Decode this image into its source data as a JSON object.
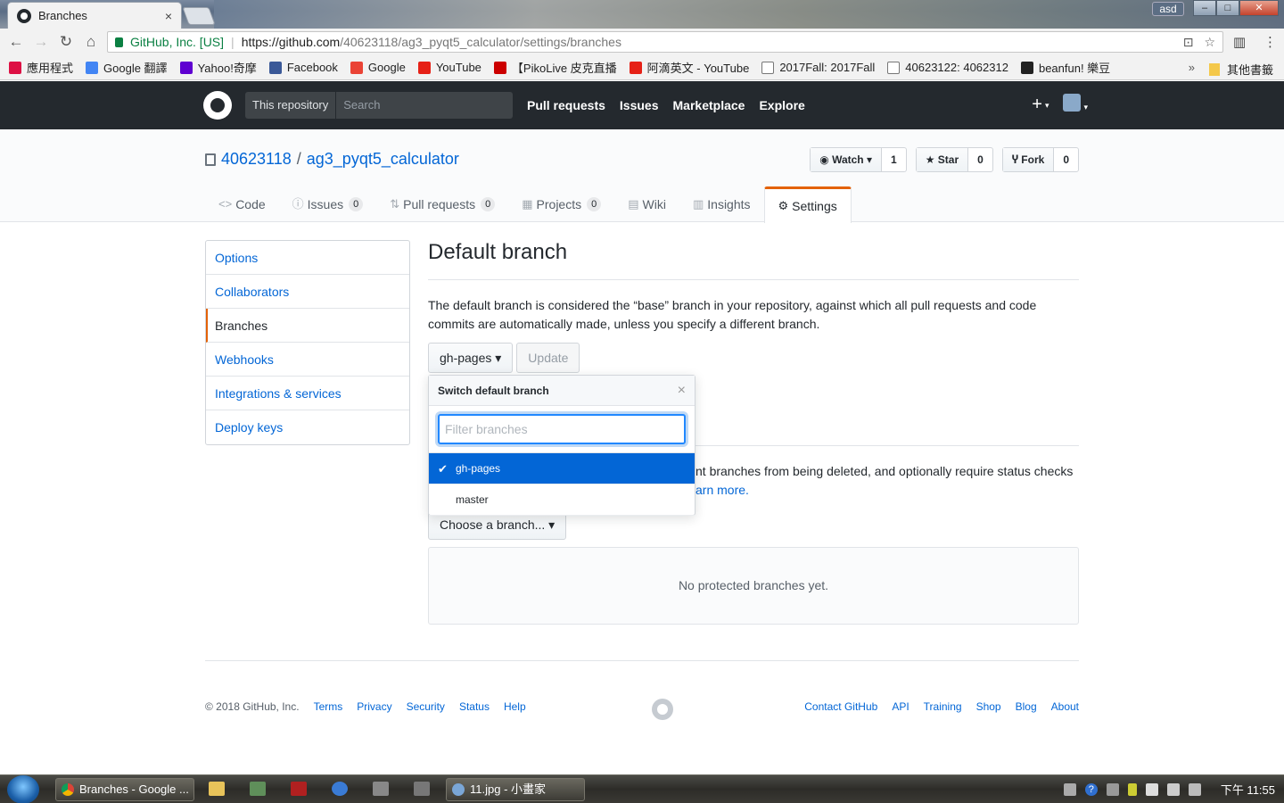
{
  "browser": {
    "tab_title": "Branches",
    "tab_close": "×",
    "profile": "asd",
    "window_min": "–",
    "window_max": "□",
    "window_close": "✕",
    "nav_back": "←",
    "nav_forward": "→",
    "nav_reload": "↻",
    "nav_home": "⌂",
    "secure_label": "GitHub, Inc. [US]",
    "url_sep": "|",
    "url_host": "https://github.com",
    "url_path": "/40623118/ag3_pyqt5_calculator/settings/branches",
    "translate_icon": "⊡",
    "star_icon": "☆",
    "ext_icon": "▥",
    "menu_icon": "⋮",
    "bookmarks": [
      {
        "label": "應用程式",
        "color": "#d14"
      },
      {
        "label": "Google 翻譯",
        "color": "#4285f4"
      },
      {
        "label": "Yahoo!奇摩",
        "color": "#5f01d1"
      },
      {
        "label": "Facebook",
        "color": "#3b5998"
      },
      {
        "label": "Google",
        "color": "#ea4335"
      },
      {
        "label": "YouTube",
        "color": "#e62117"
      },
      {
        "label": "【PikoLive 皮克直播",
        "color": "#c00"
      },
      {
        "label": "阿滴英文 - YouTube",
        "color": "#e62117"
      },
      {
        "label": "2017Fall: 2017Fall",
        "color": "#ffffff"
      },
      {
        "label": "40623122: 4062312",
        "color": "#ffffff"
      },
      {
        "label": "beanfun! 樂豆",
        "color": "#222222"
      }
    ],
    "bookmarks_more": "»",
    "bookmarks_other": "其他書籤"
  },
  "header": {
    "scope": "This repository",
    "search_placeholder": "Search",
    "nav": [
      "Pull requests",
      "Issues",
      "Marketplace",
      "Explore"
    ],
    "plus": "+",
    "caret": "▾"
  },
  "repo": {
    "owner": "40623118",
    "sep": "/",
    "name": "ag3_pyqt5_calculator",
    "watch": {
      "label": "Watch ▾",
      "icon": "◉",
      "count": "1"
    },
    "star": {
      "label": "Star",
      "icon": "★",
      "count": "0"
    },
    "fork": {
      "label": "Fork",
      "icon": "Ⴤ",
      "count": "0"
    },
    "tabs": [
      {
        "label": "Code",
        "icon": "<>",
        "count": ""
      },
      {
        "label": "Issues",
        "icon": "ⓘ",
        "count": "0"
      },
      {
        "label": "Pull requests",
        "icon": "⇅",
        "count": "0"
      },
      {
        "label": "Projects",
        "icon": "▦",
        "count": "0"
      },
      {
        "label": "Wiki",
        "icon": "▤",
        "count": ""
      },
      {
        "label": "Insights",
        "icon": "▥",
        "count": ""
      },
      {
        "label": "Settings",
        "icon": "⚙",
        "count": ""
      }
    ]
  },
  "sidebar": {
    "items": [
      "Options",
      "Collaborators",
      "Branches",
      "Webhooks",
      "Integrations & services",
      "Deploy keys"
    ]
  },
  "main": {
    "title": "Default branch",
    "description": "The default branch is considered the “base” branch in your repository, against which all pull requests and code commits are automatically made, unless you specify a different branch.",
    "branch_button": "gh-pages ▾",
    "update_button": "Update",
    "protected_text_1": "nt branches from being deleted, and optionally require status checks",
    "protected_link": "arn more.",
    "choose_button": "Choose a branch... ▾",
    "blank_state": "No protected branches yet."
  },
  "dropdown": {
    "title": "Switch default branch",
    "close": "×",
    "filter_placeholder": "Filter branches",
    "check": "✔",
    "branches": [
      "gh-pages",
      "master"
    ]
  },
  "footer": {
    "copyright": "© 2018 GitHub, Inc.",
    "left_links": [
      "Terms",
      "Privacy",
      "Security",
      "Status",
      "Help"
    ],
    "right_links": [
      "Contact GitHub",
      "API",
      "Training",
      "Shop",
      "Blog",
      "About"
    ]
  },
  "taskbar": {
    "tasks": [
      {
        "label": "Branches - Google ..."
      },
      {
        "label": "11.jpg - 小畫家"
      }
    ],
    "tray_help": "?",
    "clock": "下午 11:55"
  },
  "colors": {
    "gh_header": "#24292e",
    "link": "#0366d6",
    "accent": "#e36209",
    "dropdown_selected": "#0366d6"
  }
}
